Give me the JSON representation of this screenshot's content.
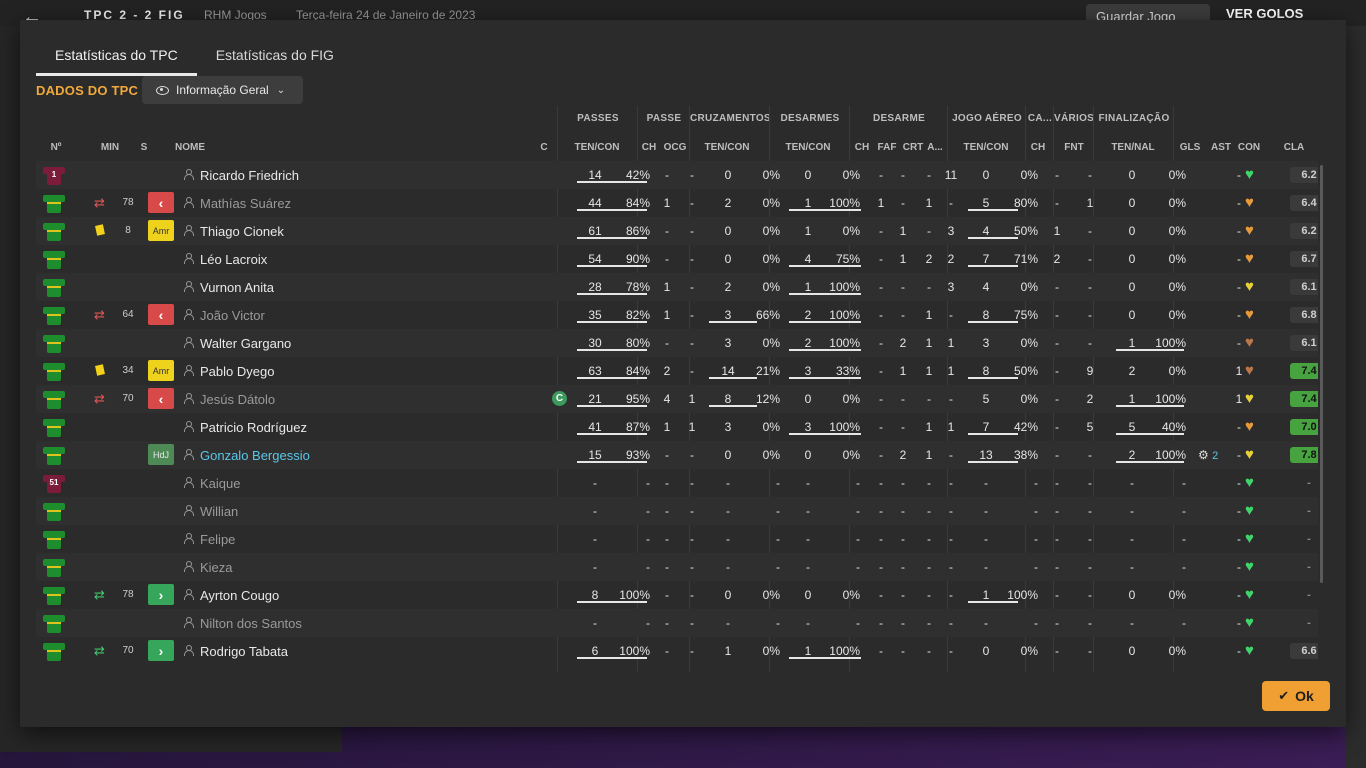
{
  "background": {
    "score": "TPC 2 - 2 FIG",
    "venue": "RHM Jogos",
    "date": "Terça-feira 24 de Janeiro de 2023",
    "save_label": "Guardar Jogo",
    "goals_label": "VER GOLOS"
  },
  "tabs": [
    "Estatísticas do TPC",
    "Estatísticas do FIG"
  ],
  "section_title": "DADOS DO TPC",
  "dropdown_label": "Informação Geral",
  "groups": [
    {
      "label": "PASSES",
      "cx": 0
    },
    {
      "label": "PASSE"
    },
    {
      "label": "CRUZAMENTOS"
    },
    {
      "label": "DESARMES"
    },
    {
      "label": "DESARME"
    },
    {
      "label": "JOGO AÉREO"
    },
    {
      "label": "CA..."
    },
    {
      "label": "VÁRIOS"
    },
    {
      "label": "FINALIZAÇÃO"
    }
  ],
  "headers": {
    "num": "Nº",
    "min": "MIN",
    "s": "S",
    "nome": "NOME",
    "c": "C",
    "passes": "TEN/CON",
    "passe_ch": "CH",
    "passe_ocg": "OCG",
    "cruz": "TEN/CON",
    "desarmes": "TEN/CON",
    "des_ch": "CH",
    "des_faf": "FAF",
    "des_crt": "CRT",
    "des_a": "A...",
    "aereo": "TEN/CON",
    "ca_ch": "CH",
    "var_fnt": "FNT",
    "fin": "TEN/NAL",
    "gls": "GLS",
    "ast": "AST",
    "con": "CON",
    "cla": "CLA"
  },
  "players": [
    {
      "num": "1",
      "gk": true,
      "sub": "",
      "min": "",
      "badge": "",
      "name": "Ricardo Friedrich",
      "cap": false,
      "p": [
        "14",
        "42%"
      ],
      "pch": "-",
      "pocg": "-",
      "cr": [
        "0",
        "0%"
      ],
      "de": [
        "0",
        "0%"
      ],
      "dch": "-",
      "faf": "-",
      "crt": "-",
      "da": "11",
      "ae": [
        "0",
        "0%"
      ],
      "cach": "-",
      "fnt": "-",
      "fi": [
        "0",
        "0%"
      ],
      "gls": "",
      "ast": "-",
      "con": "green",
      "cla": "6.2",
      "cla_hi": false,
      "grey": false,
      "hl": false,
      "bars": {
        "p": true
      }
    },
    {
      "num": "",
      "gk": false,
      "sub": "out",
      "min": "78",
      "badge": "red",
      "name": "Mathías Suárez",
      "cap": false,
      "p": [
        "44",
        "84%"
      ],
      "pch": "1",
      "pocg": "-",
      "cr": [
        "2",
        "0%"
      ],
      "de": [
        "1",
        "100%"
      ],
      "dch": "1",
      "faf": "-",
      "crt": "1",
      "da": "-",
      "ae": [
        "5",
        "80%"
      ],
      "cach": "-",
      "fnt": "1",
      "fi": [
        "0",
        "0%"
      ],
      "gls": "",
      "ast": "-",
      "con": "orange",
      "cla": "6.4",
      "cla_hi": false,
      "grey": true,
      "hl": false,
      "bars": {
        "p": true,
        "de": true,
        "ae": true
      }
    },
    {
      "num": "",
      "gk": false,
      "sub": "yellow",
      "min": "8",
      "badge": "amr",
      "name": "Thiago Cionek",
      "cap": false,
      "p": [
        "61",
        "86%"
      ],
      "pch": "-",
      "pocg": "-",
      "cr": [
        "0",
        "0%"
      ],
      "de": [
        "1",
        "0%"
      ],
      "dch": "-",
      "faf": "1",
      "crt": "-",
      "da": "3",
      "ae": [
        "4",
        "50%"
      ],
      "cach": "1",
      "fnt": "-",
      "fi": [
        "0",
        "0%"
      ],
      "gls": "",
      "ast": "-",
      "con": "orange",
      "cla": "6.2",
      "cla_hi": false,
      "grey": false,
      "hl": false,
      "bars": {
        "p": true,
        "ae": true
      }
    },
    {
      "num": "",
      "gk": false,
      "sub": "",
      "min": "",
      "badge": "",
      "name": "Léo Lacroix",
      "cap": false,
      "p": [
        "54",
        "90%"
      ],
      "pch": "-",
      "pocg": "-",
      "cr": [
        "0",
        "0%"
      ],
      "de": [
        "4",
        "75%"
      ],
      "dch": "-",
      "faf": "1",
      "crt": "2",
      "da": "2",
      "ae": [
        "7",
        "71%"
      ],
      "cach": "2",
      "fnt": "-",
      "fi": [
        "0",
        "0%"
      ],
      "gls": "",
      "ast": "-",
      "con": "orange",
      "cla": "6.7",
      "cla_hi": false,
      "grey": false,
      "hl": false,
      "bars": {
        "p": true,
        "de": true,
        "ae": true
      }
    },
    {
      "num": "",
      "gk": false,
      "sub": "",
      "min": "",
      "badge": "",
      "name": "Vurnon Anita",
      "cap": false,
      "p": [
        "28",
        "78%"
      ],
      "pch": "1",
      "pocg": "-",
      "cr": [
        "2",
        "0%"
      ],
      "de": [
        "1",
        "100%"
      ],
      "dch": "-",
      "faf": "-",
      "crt": "-",
      "da": "3",
      "ae": [
        "4",
        "0%"
      ],
      "cach": "-",
      "fnt": "-",
      "fi": [
        "0",
        "0%"
      ],
      "gls": "",
      "ast": "-",
      "con": "yellow",
      "cla": "6.1",
      "cla_hi": false,
      "grey": false,
      "hl": false,
      "bars": {
        "p": true,
        "de": true
      }
    },
    {
      "num": "",
      "gk": false,
      "sub": "out",
      "min": "64",
      "badge": "red",
      "name": "João Victor",
      "cap": false,
      "p": [
        "35",
        "82%"
      ],
      "pch": "1",
      "pocg": "-",
      "cr": [
        "3",
        "66%"
      ],
      "de": [
        "2",
        "100%"
      ],
      "dch": "-",
      "faf": "-",
      "crt": "1",
      "da": "-",
      "ae": [
        "8",
        "75%"
      ],
      "cach": "-",
      "fnt": "-",
      "fi": [
        "0",
        "0%"
      ],
      "gls": "",
      "ast": "-",
      "con": "orange",
      "cla": "6.8",
      "cla_hi": false,
      "grey": true,
      "hl": false,
      "bars": {
        "p": true,
        "cr": true,
        "de": true,
        "ae": true
      }
    },
    {
      "num": "",
      "gk": false,
      "sub": "",
      "min": "",
      "badge": "",
      "name": "Walter Gargano",
      "cap": false,
      "p": [
        "30",
        "80%"
      ],
      "pch": "-",
      "pocg": "-",
      "cr": [
        "3",
        "0%"
      ],
      "de": [
        "2",
        "100%"
      ],
      "dch": "-",
      "faf": "2",
      "crt": "1",
      "da": "1",
      "ae": [
        "3",
        "0%"
      ],
      "cach": "-",
      "fnt": "-",
      "fi": [
        "1",
        "100%"
      ],
      "gls": "",
      "ast": "-",
      "con": "brown",
      "cla": "6.1",
      "cla_hi": false,
      "grey": false,
      "hl": false,
      "bars": {
        "p": true,
        "de": true,
        "fi": true
      }
    },
    {
      "num": "",
      "gk": false,
      "sub": "yellow",
      "min": "34",
      "badge": "amr",
      "name": "Pablo Dyego",
      "cap": false,
      "p": [
        "63",
        "84%"
      ],
      "pch": "2",
      "pocg": "-",
      "cr": [
        "14",
        "21%"
      ],
      "de": [
        "3",
        "33%"
      ],
      "dch": "-",
      "faf": "1",
      "crt": "1",
      "da": "1",
      "ae": [
        "8",
        "50%"
      ],
      "cach": "-",
      "fnt": "9",
      "fi": [
        "2",
        "0%"
      ],
      "gls": "",
      "ast": "1",
      "con": "brown",
      "cla": "7.4",
      "cla_hi": true,
      "grey": false,
      "hl": false,
      "bars": {
        "p": true,
        "cr": true,
        "de": true,
        "ae": true
      }
    },
    {
      "num": "",
      "gk": false,
      "sub": "out",
      "min": "70",
      "badge": "red",
      "name": "Jesús Dátolo",
      "cap": true,
      "p": [
        "21",
        "95%"
      ],
      "pch": "4",
      "pocg": "1",
      "cr": [
        "8",
        "12%"
      ],
      "de": [
        "0",
        "0%"
      ],
      "dch": "-",
      "faf": "-",
      "crt": "-",
      "da": "-",
      "ae": [
        "5",
        "0%"
      ],
      "cach": "-",
      "fnt": "2",
      "fi": [
        "1",
        "100%"
      ],
      "gls": "",
      "ast": "1",
      "con": "yellow",
      "cla": "7.4",
      "cla_hi": true,
      "grey": true,
      "hl": false,
      "bars": {
        "p": true,
        "cr": true,
        "fi": true
      }
    },
    {
      "num": "",
      "gk": false,
      "sub": "",
      "min": "",
      "badge": "",
      "name": "Patricio Rodríguez",
      "cap": false,
      "p": [
        "41",
        "87%"
      ],
      "pch": "1",
      "pocg": "1",
      "cr": [
        "3",
        "0%"
      ],
      "de": [
        "3",
        "100%"
      ],
      "dch": "-",
      "faf": "-",
      "crt": "1",
      "da": "1",
      "ae": [
        "7",
        "42%"
      ],
      "cach": "-",
      "fnt": "5",
      "fi": [
        "5",
        "40%"
      ],
      "gls": "",
      "ast": "-",
      "con": "orange",
      "cla": "7.0",
      "cla_hi": true,
      "grey": false,
      "hl": false,
      "bars": {
        "p": true,
        "de": true,
        "ae": true,
        "fi": true
      }
    },
    {
      "num": "",
      "gk": false,
      "sub": "",
      "min": "",
      "badge": "hdj",
      "name": "Gonzalo Bergessio",
      "cap": false,
      "p": [
        "15",
        "93%"
      ],
      "pch": "-",
      "pocg": "-",
      "cr": [
        "0",
        "0%"
      ],
      "de": [
        "0",
        "0%"
      ],
      "dch": "-",
      "faf": "2",
      "crt": "1",
      "da": "-",
      "ae": [
        "13",
        "38%"
      ],
      "cach": "-",
      "fnt": "-",
      "fi": [
        "2",
        "100%"
      ],
      "gls": "2",
      "ast": "-",
      "con": "yellow",
      "cla": "7.8",
      "cla_hi": true,
      "grey": false,
      "hl": true,
      "bars": {
        "p": true,
        "ae": true,
        "fi": true
      }
    },
    {
      "num": "51",
      "gk": true,
      "sub": "",
      "min": "",
      "badge": "",
      "name": "Kaique",
      "cap": false,
      "p": [
        "-",
        "-"
      ],
      "pch": "-",
      "pocg": "-",
      "cr": [
        "-",
        "-"
      ],
      "de": [
        "-",
        "-"
      ],
      "dch": "-",
      "faf": "-",
      "crt": "-",
      "da": "-",
      "ae": [
        "-",
        "-"
      ],
      "cach": "-",
      "fnt": "-",
      "fi": [
        "-",
        "-"
      ],
      "gls": "",
      "ast": "-",
      "con": "green",
      "cla": "-",
      "cla_hi": false,
      "grey": true,
      "hl": false,
      "bars": {}
    },
    {
      "num": "",
      "gk": false,
      "sub": "",
      "min": "",
      "badge": "",
      "name": "Willian",
      "cap": false,
      "p": [
        "-",
        "-"
      ],
      "pch": "-",
      "pocg": "-",
      "cr": [
        "-",
        "-"
      ],
      "de": [
        "-",
        "-"
      ],
      "dch": "-",
      "faf": "-",
      "crt": "-",
      "da": "-",
      "ae": [
        "-",
        "-"
      ],
      "cach": "-",
      "fnt": "-",
      "fi": [
        "-",
        "-"
      ],
      "gls": "",
      "ast": "-",
      "con": "green",
      "cla": "-",
      "cla_hi": false,
      "grey": true,
      "hl": false,
      "bars": {}
    },
    {
      "num": "",
      "gk": false,
      "sub": "",
      "min": "",
      "badge": "",
      "name": "Felipe",
      "cap": false,
      "p": [
        "-",
        "-"
      ],
      "pch": "-",
      "pocg": "-",
      "cr": [
        "-",
        "-"
      ],
      "de": [
        "-",
        "-"
      ],
      "dch": "-",
      "faf": "-",
      "crt": "-",
      "da": "-",
      "ae": [
        "-",
        "-"
      ],
      "cach": "-",
      "fnt": "-",
      "fi": [
        "-",
        "-"
      ],
      "gls": "",
      "ast": "-",
      "con": "green",
      "cla": "-",
      "cla_hi": false,
      "grey": true,
      "hl": false,
      "bars": {}
    },
    {
      "num": "",
      "gk": false,
      "sub": "",
      "min": "",
      "badge": "",
      "name": "Kieza",
      "cap": false,
      "p": [
        "-",
        "-"
      ],
      "pch": "-",
      "pocg": "-",
      "cr": [
        "-",
        "-"
      ],
      "de": [
        "-",
        "-"
      ],
      "dch": "-",
      "faf": "-",
      "crt": "-",
      "da": "-",
      "ae": [
        "-",
        "-"
      ],
      "cach": "-",
      "fnt": "-",
      "fi": [
        "-",
        "-"
      ],
      "gls": "",
      "ast": "-",
      "con": "green",
      "cla": "-",
      "cla_hi": false,
      "grey": true,
      "hl": false,
      "bars": {}
    },
    {
      "num": "",
      "gk": false,
      "sub": "in",
      "min": "78",
      "badge": "green",
      "name": "Ayrton Cougo",
      "cap": false,
      "p": [
        "8",
        "100%"
      ],
      "pch": "-",
      "pocg": "-",
      "cr": [
        "0",
        "0%"
      ],
      "de": [
        "0",
        "0%"
      ],
      "dch": "-",
      "faf": "-",
      "crt": "-",
      "da": "-",
      "ae": [
        "1",
        "100%"
      ],
      "cach": "-",
      "fnt": "-",
      "fi": [
        "0",
        "0%"
      ],
      "gls": "",
      "ast": "-",
      "con": "green",
      "cla": "-",
      "cla_hi": false,
      "grey": false,
      "hl": false,
      "bars": {
        "p": true,
        "ae": true
      }
    },
    {
      "num": "",
      "gk": false,
      "sub": "",
      "min": "",
      "badge": "",
      "name": "Nilton dos Santos",
      "cap": false,
      "p": [
        "-",
        "-"
      ],
      "pch": "-",
      "pocg": "-",
      "cr": [
        "-",
        "-"
      ],
      "de": [
        "-",
        "-"
      ],
      "dch": "-",
      "faf": "-",
      "crt": "-",
      "da": "-",
      "ae": [
        "-",
        "-"
      ],
      "cach": "-",
      "fnt": "-",
      "fi": [
        "-",
        "-"
      ],
      "gls": "",
      "ast": "-",
      "con": "green",
      "cla": "-",
      "cla_hi": false,
      "grey": true,
      "hl": false,
      "bars": {}
    },
    {
      "num": "",
      "gk": false,
      "sub": "in",
      "min": "70",
      "badge": "green",
      "name": "Rodrigo Tabata",
      "cap": false,
      "p": [
        "6",
        "100%"
      ],
      "pch": "-",
      "pocg": "-",
      "cr": [
        "1",
        "0%"
      ],
      "de": [
        "1",
        "100%"
      ],
      "dch": "-",
      "faf": "-",
      "crt": "-",
      "da": "-",
      "ae": [
        "0",
        "0%"
      ],
      "cach": "-",
      "fnt": "-",
      "fi": [
        "0",
        "0%"
      ],
      "gls": "",
      "ast": "-",
      "con": "green",
      "cla": "6.6",
      "cla_hi": false,
      "grey": false,
      "hl": false,
      "bars": {
        "p": true,
        "de": true
      }
    }
  ],
  "badge_text": {
    "amr": "Amr",
    "hdj": "HdJ",
    "red": "‹",
    "green": "›"
  },
  "ok_label": "Ok"
}
